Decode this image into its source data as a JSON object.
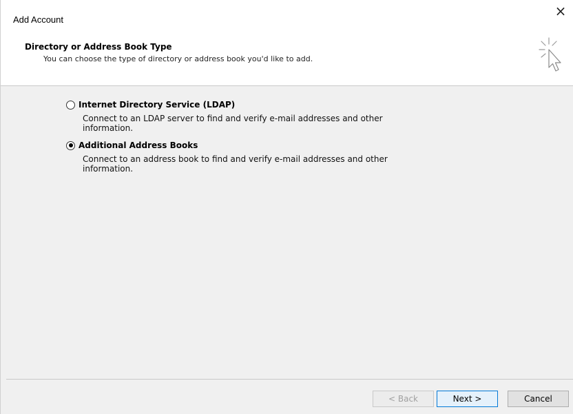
{
  "window": {
    "title": "Add Account",
    "close_label": "×"
  },
  "header": {
    "title": "Directory or Address Book Type",
    "subtitle": "You can choose the type of directory or address book you'd like to add.",
    "icon": "wizard-cursor-icon"
  },
  "options": [
    {
      "label": "Internet Directory Service (LDAP)",
      "description": "Connect to an LDAP server to find and verify e-mail addresses and other information.",
      "selected": false
    },
    {
      "label": "Additional Address Books",
      "description": "Connect to an address book to find and verify e-mail addresses and other information.",
      "selected": true
    }
  ],
  "footer": {
    "back_label": "< Back",
    "next_label": "Next >",
    "cancel_label": "Cancel"
  },
  "colors": {
    "accent": "#0078d7",
    "background": "#f0f0f0",
    "header_bg": "#ffffff"
  }
}
